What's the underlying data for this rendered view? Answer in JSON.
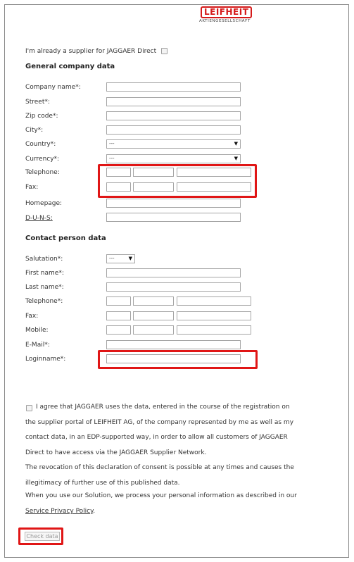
{
  "logo": {
    "brand": "LEIFHEIT",
    "subtitle": "AKTIENGESELLSCHAFT"
  },
  "supplier_check_label": "I'm already a supplier for JAGGAER Direct",
  "company": {
    "heading": "General company data",
    "company_name": "Company name*:",
    "street": "Street*:",
    "zip": "Zip code*:",
    "city": "City*:",
    "country": "Country*:",
    "country_value": "---",
    "currency": "Currency*:",
    "currency_value": "---",
    "telephone": "Telephone:",
    "fax": "Fax:",
    "homepage": "Homepage:",
    "duns": "D-U-N-S:"
  },
  "contact": {
    "heading": "Contact person data",
    "salutation": "Salutation*:",
    "salutation_value": "---",
    "first_name": "First name*:",
    "last_name": "Last name*:",
    "telephone": "Telephone*:",
    "fax": "Fax:",
    "mobile": "Mobile:",
    "email": "E-Mail*:",
    "loginname": "Loginname*:"
  },
  "consent": {
    "line1": "I agree that JAGGAER uses the data, entered in the course of the registration on",
    "line2": "the supplier portal of LEIFHEIT AG, of the company represented by me as well as my",
    "line3": "contact data, in an EDP-supported way, in order to allow all customers of JAGGAER",
    "line4": "Direct to have access via the JAGGAER Supplier Network.",
    "line5": "The revocation of this declaration of consent is possible at any times and causes the",
    "line6": "illegitimacy of further use of this published data."
  },
  "privacy": {
    "text": "When you use our Solution, we process your personal information as described in our",
    "link": "Service Privacy Policy",
    "suffix": "."
  },
  "check_button": "Check data",
  "colors": {
    "highlight": "#e01616",
    "brand": "#d51a1a"
  }
}
